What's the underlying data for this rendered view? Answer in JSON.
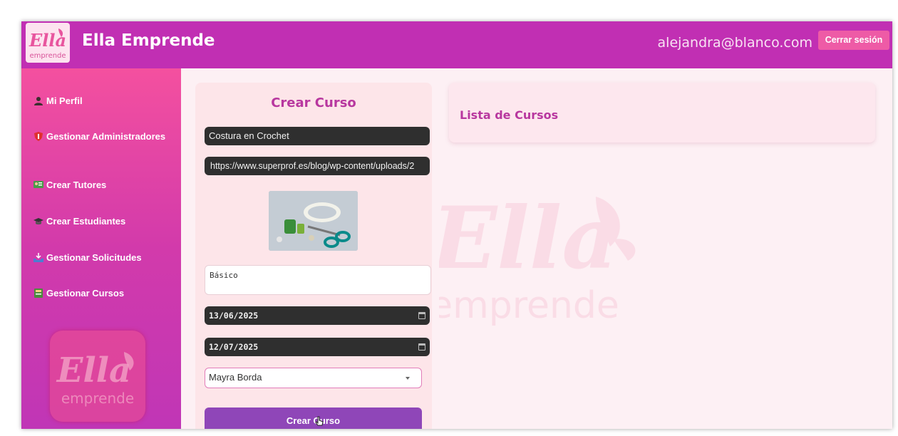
{
  "header": {
    "app_title": "Ella Emprende",
    "logo_text": "Ella emprende",
    "user_email": "alejandra@blanco.com",
    "logout_label": "Cerrar sesión"
  },
  "sidebar": {
    "items": [
      {
        "label": "Mi Perfil",
        "icon": "user-icon"
      },
      {
        "label": "Gestionar Administradores",
        "icon": "shield-icon"
      },
      {
        "label": "Crear Tutores",
        "icon": "teacher-icon"
      },
      {
        "label": "Crear Estudiantes",
        "icon": "graduation-cap-icon"
      },
      {
        "label": "Gestionar Solicitudes",
        "icon": "inbox-tray-icon"
      },
      {
        "label": "Gestionar Cursos",
        "icon": "book-icon"
      }
    ],
    "logo_text": "Ella emprende"
  },
  "form": {
    "title": "Crear Curso",
    "course_name": "Costura en Crochet",
    "image_url": "https://www.superprof.es/blog/wp-content/uploads/2",
    "image_alt": "sewing supplies: scissors, thread and measuring tape",
    "level": "Básico",
    "start_date": "13/06/2025",
    "end_date": "12/07/2025",
    "tutor": "Mayra Borda",
    "submit_label": "Crear Curso"
  },
  "list": {
    "title": "Lista de Cursos"
  },
  "colors": {
    "header": "#c12fb3",
    "sidebar_top": "#f4509f",
    "sidebar_bottom": "#c036b6",
    "accent_title": "#b8379f",
    "logout_button": "#ee5ba6",
    "submit_button": "#8f46b8",
    "input_dark": "#2f2f2f",
    "page_bg": "#fdf0f4"
  },
  "watermark_text": "Ella emprende"
}
